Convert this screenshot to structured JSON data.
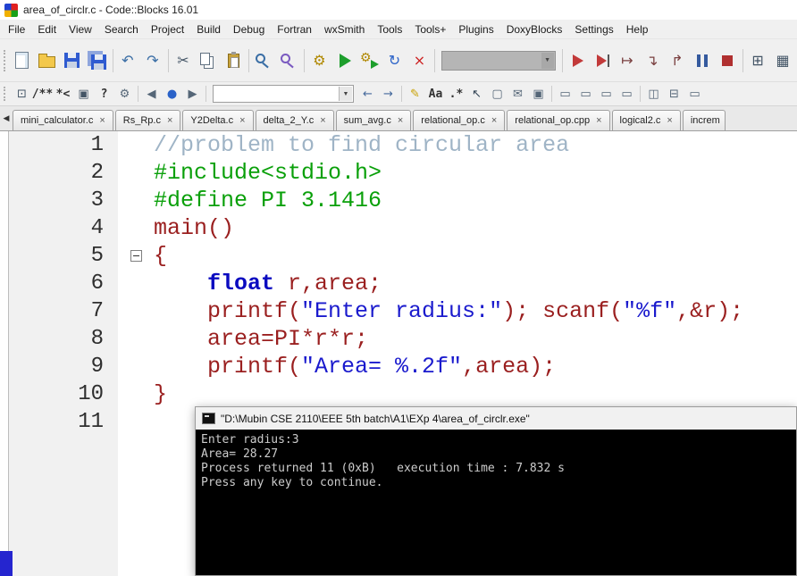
{
  "window": {
    "title": "area_of_circlr.c - Code::Blocks 16.01"
  },
  "menu": {
    "items": [
      "File",
      "Edit",
      "View",
      "Search",
      "Project",
      "Build",
      "Debug",
      "Fortran",
      "wxSmith",
      "Tools",
      "Tools+",
      "Plugins",
      "DoxyBlocks",
      "Settings",
      "Help"
    ]
  },
  "toolbar_main": {
    "items": [
      {
        "type": "grip"
      },
      {
        "name": "new-file-button",
        "icon": "new-file-icon",
        "shape": "page"
      },
      {
        "name": "open-file-button",
        "icon": "open-folder-icon",
        "shape": "folder"
      },
      {
        "name": "save-button",
        "icon": "floppy-disk-icon",
        "shape": "floppy"
      },
      {
        "name": "save-all-button",
        "icon": "floppy-stack-icon",
        "shape": "floppy-stack"
      },
      {
        "type": "sep"
      },
      {
        "name": "undo-button",
        "icon": "undo-arrow-icon",
        "glyph": "↶",
        "color": "#3a6ea5"
      },
      {
        "name": "redo-button",
        "icon": "redo-arrow-icon",
        "glyph": "↷",
        "color": "#3a6ea5"
      },
      {
        "type": "sep"
      },
      {
        "name": "cut-button",
        "icon": "scissors-icon",
        "glyph": "✂",
        "color": "#445566"
      },
      {
        "name": "copy-button",
        "icon": "copy-pages-icon",
        "shape": "copy"
      },
      {
        "name": "paste-button",
        "icon": "clipboard-icon",
        "shape": "paste"
      },
      {
        "type": "sep"
      },
      {
        "name": "find-button",
        "icon": "magnifier-icon",
        "shape": "magnifier"
      },
      {
        "name": "replace-button",
        "icon": "magnifier-replace-icon",
        "shape": "magnifier-plus"
      },
      {
        "type": "sep"
      },
      {
        "name": "build-button",
        "icon": "gear-icon",
        "glyph": "⚙",
        "color": "#b08800"
      },
      {
        "name": "run-button",
        "icon": "play-icon",
        "shape": "play"
      },
      {
        "name": "build-and-run-button",
        "icon": "gear-play-icon",
        "shape": "gear-play"
      },
      {
        "name": "rebuild-button",
        "icon": "circular-arrows-icon",
        "glyph": "↻",
        "color": "#2a62c8"
      },
      {
        "name": "abort-button",
        "icon": "red-cross-icon",
        "glyph": "×",
        "color": "#cc2222"
      },
      {
        "type": "sep"
      },
      {
        "type": "combo",
        "name": "build-target-combo",
        "disabled": true,
        "width": 128,
        "value": ""
      },
      {
        "type": "sep"
      },
      {
        "name": "debug-continue-button",
        "icon": "debug-play-icon",
        "shape": "play-red"
      },
      {
        "name": "run-to-cursor-button",
        "icon": "play-to-line-icon",
        "shape": "play-line"
      },
      {
        "name": "next-line-button",
        "icon": "arrow-over-icon",
        "glyph": "↦",
        "color": "#7a4040"
      },
      {
        "name": "step-into-button",
        "icon": "arrow-into-icon",
        "glyph": "↴",
        "color": "#7a4040"
      },
      {
        "name": "step-out-button",
        "icon": "arrow-out-icon",
        "glyph": "↱",
        "color": "#7a4040"
      },
      {
        "name": "break-debugger-button",
        "icon": "pause-icon",
        "shape": "pause"
      },
      {
        "name": "stop-debugger-button",
        "icon": "stop-icon",
        "shape": "stop"
      },
      {
        "type": "sep"
      },
      {
        "name": "debugging-windows-button",
        "icon": "grid-window-icon",
        "glyph": "⊞",
        "color": "#445566"
      },
      {
        "name": "various-info-button",
        "icon": "info-window-icon",
        "glyph": "▦",
        "color": "#445566"
      }
    ]
  },
  "toolbar_secondary": {
    "items": [
      {
        "type": "grip"
      },
      {
        "name": "doxy-wizard-button",
        "icon": "doxy-window-icon",
        "glyph": "⊡",
        "color": "#445566"
      },
      {
        "name": "doxy-block-comment-button",
        "icon": "block-comment-icon",
        "glyph": "/**",
        "text": true
      },
      {
        "name": "doxy-line-comment-button",
        "icon": "line-comment-icon",
        "glyph": "*<",
        "text": true
      },
      {
        "name": "doxy-run-html-button",
        "icon": "html-doc-icon",
        "glyph": "▣",
        "color": "#445566"
      },
      {
        "name": "doxy-run-chm-button",
        "icon": "chm-doc-icon",
        "glyph": "?",
        "text": true
      },
      {
        "name": "doxy-config-button",
        "icon": "gear-icon",
        "glyph": "⚙",
        "color": "#556677"
      },
      {
        "type": "sep"
      },
      {
        "name": "prev-bookmark-button",
        "icon": "prev-arrow-icon",
        "glyph": "◀",
        "color": "#556677"
      },
      {
        "name": "toggle-bookmark-button",
        "icon": "bookmark-dot-icon",
        "glyph": "●",
        "color": "#2a62c8"
      },
      {
        "name": "next-bookmark-button",
        "icon": "next-arrow-icon",
        "glyph": "▶",
        "color": "#556677"
      },
      {
        "type": "sep"
      },
      {
        "type": "combo",
        "name": "search-scope-combo",
        "width": 158,
        "value": ""
      },
      {
        "name": "search-prev-button",
        "icon": "left-arrow-icon",
        "glyph": "←",
        "color": "#44699c"
      },
      {
        "name": "search-next-button",
        "icon": "right-arrow-icon",
        "glyph": "→",
        "color": "#44699c"
      },
      {
        "type": "sep"
      },
      {
        "name": "highlight-occurrences-button",
        "icon": "highlighter-icon",
        "glyph": "✎",
        "color": "#c8a000"
      },
      {
        "name": "match-case-button",
        "icon": "match-case-icon",
        "glyph": "Aa",
        "text": true
      },
      {
        "name": "regex-button",
        "icon": "regex-icon",
        "glyph": ".*",
        "text": true
      },
      {
        "name": "pointer-button",
        "icon": "pointer-icon",
        "glyph": "↖",
        "color": "#334455"
      },
      {
        "name": "clear-search-button",
        "icon": "empty-box-icon",
        "glyph": "▢",
        "color": "#556677"
      },
      {
        "name": "mail-button",
        "icon": "envelope-icon",
        "glyph": "✉",
        "color": "#556677"
      },
      {
        "name": "window-button",
        "icon": "window-icon",
        "glyph": "▣",
        "color": "#556677"
      },
      {
        "type": "sep"
      },
      {
        "name": "panel-toggle-button-1",
        "icon": "bar-icon",
        "glyph": "▭",
        "color": "#556677"
      },
      {
        "name": "panel-toggle-button-2",
        "icon": "bar-icon",
        "glyph": "▭",
        "color": "#556677"
      },
      {
        "name": "panel-toggle-button-3",
        "icon": "bar-icon",
        "glyph": "▭",
        "color": "#556677"
      },
      {
        "name": "panel-toggle-button-4",
        "icon": "bar-icon",
        "glyph": "▭",
        "color": "#556677"
      },
      {
        "type": "sep"
      },
      {
        "name": "split-view-button",
        "icon": "split-window-icon",
        "glyph": "◫",
        "color": "#556677"
      },
      {
        "name": "boxed-view-button",
        "icon": "boxed-window-icon",
        "glyph": "⊟",
        "color": "#556677"
      },
      {
        "name": "wide-view-button",
        "icon": "wide-window-icon",
        "glyph": "▭",
        "color": "#556677"
      }
    ]
  },
  "tabs": {
    "scroll_left_glyph": "◀",
    "close_glyph": "×",
    "items": [
      {
        "label": "mini_calculator.c"
      },
      {
        "label": "Rs_Rp.c"
      },
      {
        "label": "Y2Delta.c"
      },
      {
        "label": "delta_2_Y.c"
      },
      {
        "label": "sum_avg.c"
      },
      {
        "label": "relational_op.c"
      },
      {
        "label": "relational_op.cpp"
      },
      {
        "label": "logical2.c"
      },
      {
        "label": "increm",
        "partial": true
      }
    ]
  },
  "editor": {
    "lines": [
      {
        "num": "1",
        "tokens": [
          {
            "t": "//problem to find circular area",
            "c": "com"
          }
        ]
      },
      {
        "num": "2",
        "tokens": [
          {
            "t": "#include<stdio.h>",
            "c": "pre"
          }
        ]
      },
      {
        "num": "3",
        "tokens": [
          {
            "t": "#define PI 3.1416",
            "c": "pre"
          }
        ]
      },
      {
        "num": "4",
        "tokens": [
          {
            "t": "main()",
            "c": "pln"
          }
        ]
      },
      {
        "num": "5",
        "fold": "open",
        "tokens": [
          {
            "t": "{",
            "c": "pln"
          }
        ]
      },
      {
        "num": "6",
        "tokens": [
          {
            "t": "    ",
            "c": "pln"
          },
          {
            "t": "float",
            "c": "kw"
          },
          {
            "t": " r,area;",
            "c": "pln"
          }
        ]
      },
      {
        "num": "7",
        "tokens": [
          {
            "t": "    printf(",
            "c": "pln"
          },
          {
            "t": "\"Enter radius:\"",
            "c": "str"
          },
          {
            "t": "); scanf(",
            "c": "pln"
          },
          {
            "t": "\"%f\"",
            "c": "str"
          },
          {
            "t": ",&r);",
            "c": "pln"
          }
        ]
      },
      {
        "num": "8",
        "tokens": [
          {
            "t": "    area=PI*r*r;",
            "c": "pln"
          }
        ]
      },
      {
        "num": "9",
        "tokens": [
          {
            "t": "    printf(",
            "c": "pln"
          },
          {
            "t": "\"Area= %.2f\"",
            "c": "str"
          },
          {
            "t": ",area);",
            "c": "pln"
          }
        ]
      },
      {
        "num": "10",
        "tokens": [
          {
            "t": "}",
            "c": "pln"
          }
        ]
      },
      {
        "num": "11",
        "tokens": []
      }
    ]
  },
  "console": {
    "title": "\"D:\\Mubin CSE 2110\\EEE 5th batch\\A1\\EXp 4\\area_of_circlr.exe\"",
    "lines": [
      "Enter radius:3",
      "Area= 28.27",
      "Process returned 11 (0xB)   execution time : 7.832 s",
      "Press any key to continue."
    ]
  },
  "colors": {
    "plain": "#9a1f1f",
    "keyword": "#0b0bc0",
    "string": "#1a1acd",
    "preprocessor": "#0aa00a",
    "comment": "#9fb4c6",
    "gutter_bg": "#f1f1f1",
    "toolbar_bg": "#f0f0f0",
    "console_bg": "#000000",
    "console_fg": "#cccccc",
    "panel_blue": "#2525cf"
  }
}
